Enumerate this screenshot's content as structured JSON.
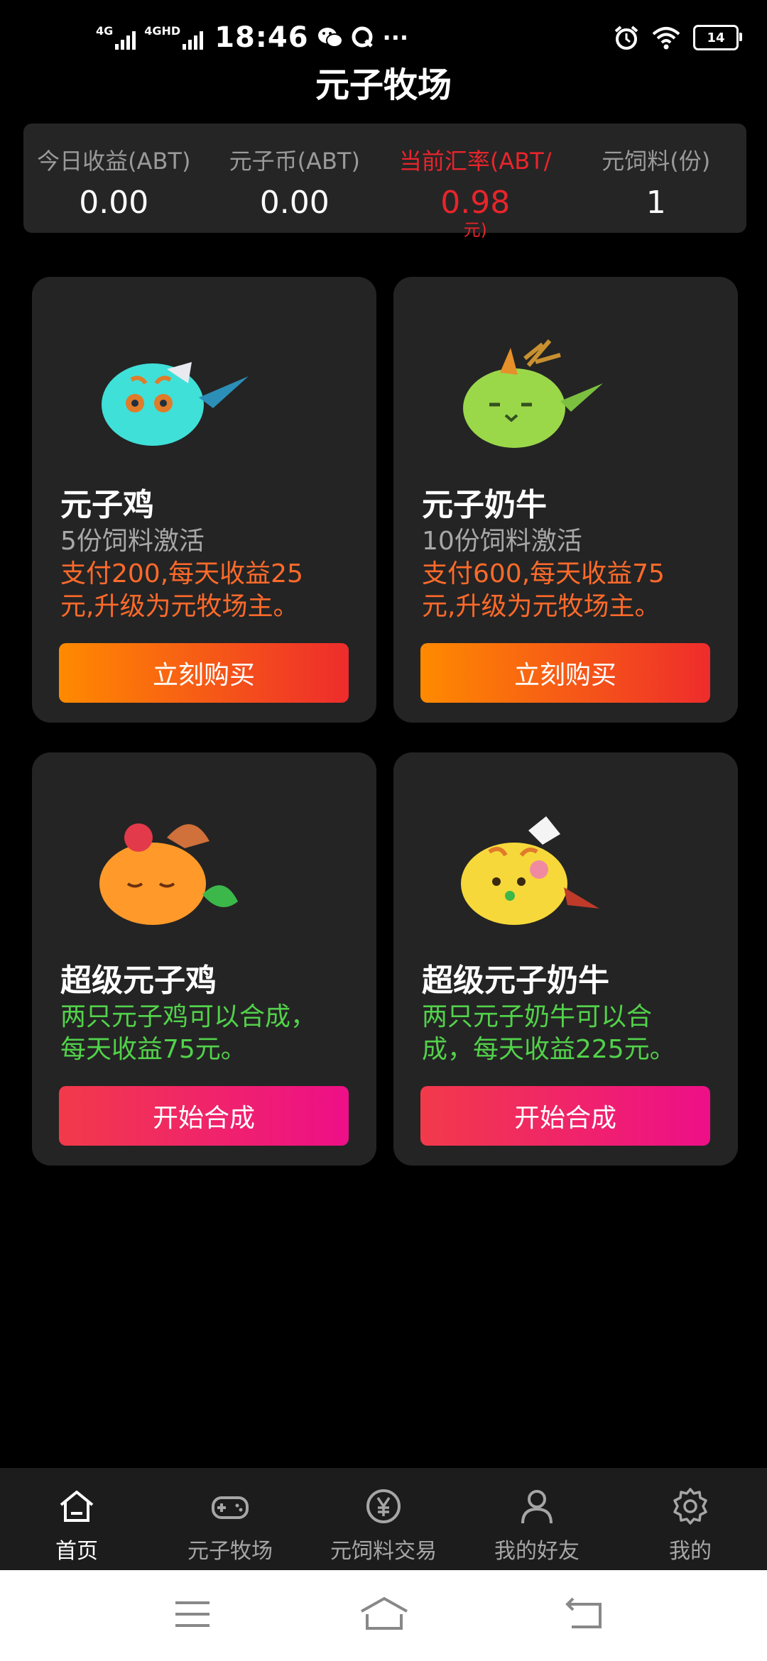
{
  "status_bar": {
    "net1": "4G",
    "net2": "4GHD",
    "time": "18:46",
    "more": "···",
    "battery": "14"
  },
  "page": {
    "title": "元子牧场"
  },
  "stats": [
    {
      "label": "今日收益(ABT)",
      "value": "0.00"
    },
    {
      "label": "元子币(ABT)",
      "value": "0.00"
    },
    {
      "label": "当前汇率(ABT/",
      "value": "0.98",
      "sub": "元)"
    },
    {
      "label": "元饲料(份)",
      "value": "1"
    }
  ],
  "cards": [
    {
      "name": "元子鸡",
      "activation": "5份饲料激活",
      "desc_line1": "支付200,每天收益25",
      "desc_line2": "元,升级为元牧场主。",
      "button": "立刻购买",
      "color": "#3fe0d8"
    },
    {
      "name": "元子奶牛",
      "activation": "10份饲料激活",
      "desc_line1": "支付600,每天收益75",
      "desc_line2": "元,升级为元牧场主。",
      "button": "立刻购买",
      "color": "#9ad84a"
    },
    {
      "name": "超级元子鸡",
      "desc_line1": "两只元子鸡可以合成，",
      "desc_line2": "每天收益75元。",
      "button": "开始合成",
      "color": "#ff9a2a"
    },
    {
      "name": "超级元子奶牛",
      "desc_line1": "两只元子奶牛可以合",
      "desc_line2": "成，每天收益225元。",
      "button": "开始合成",
      "color": "#f6d83a"
    }
  ],
  "tabs": [
    {
      "label": "首页",
      "icon": "home-icon",
      "active": true
    },
    {
      "label": "元子牧场",
      "icon": "gamepad-icon"
    },
    {
      "label": "元饲料交易",
      "icon": "yen-coin-icon"
    },
    {
      "label": "我的好友",
      "icon": "person-icon"
    },
    {
      "label": "我的",
      "icon": "gear-icon"
    }
  ]
}
